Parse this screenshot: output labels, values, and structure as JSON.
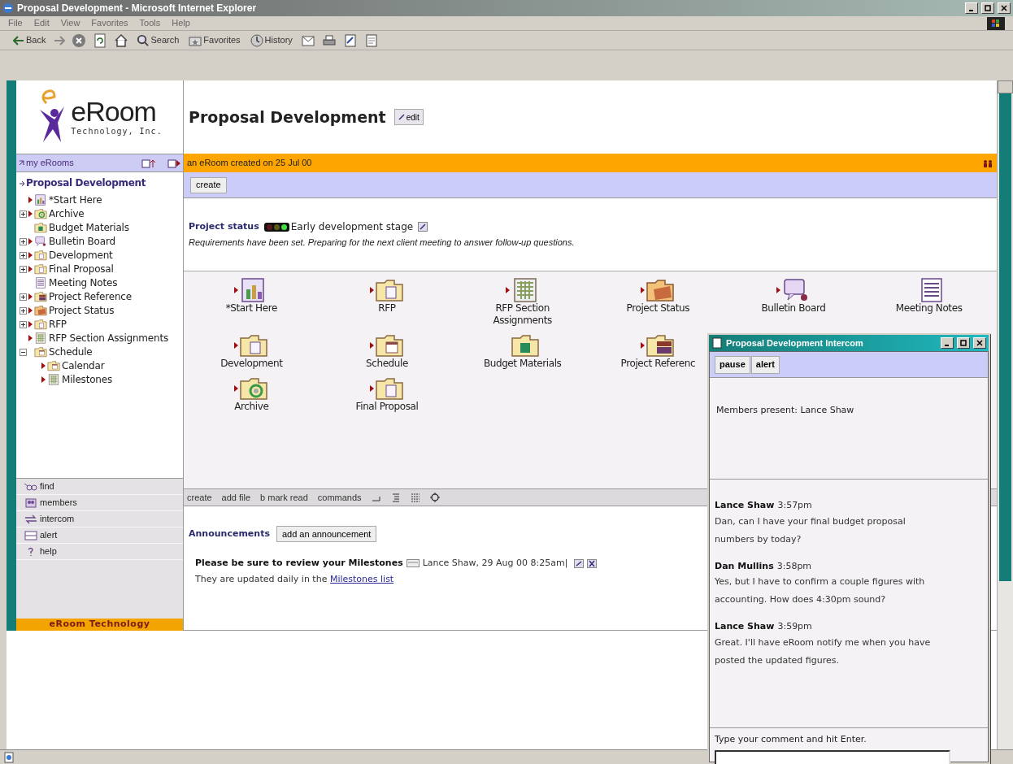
{
  "window": {
    "title": "Proposal Development - Microsoft Internet Explorer"
  },
  "menu": [
    "File",
    "Edit",
    "View",
    "Favorites",
    "Tools",
    "Help"
  ],
  "toolbar": [
    {
      "kind": "back",
      "label": "Back"
    },
    {
      "kind": "forward"
    },
    {
      "kind": "stop"
    },
    {
      "kind": "refresh"
    },
    {
      "kind": "home"
    },
    {
      "kind": "search",
      "label": "Search"
    },
    {
      "kind": "favorites",
      "label": "Favorites"
    },
    {
      "kind": "history",
      "label": "History"
    },
    {
      "kind": "mail"
    },
    {
      "kind": "print"
    },
    {
      "kind": "edit"
    },
    {
      "kind": "discuss"
    }
  ],
  "logo": {
    "name": "eRoom",
    "tagline": "Technology, Inc."
  },
  "sidebar": {
    "home_link": "my eRooms",
    "room_title": "Proposal Development",
    "tree": [
      {
        "label": "*Start Here",
        "kind": "start",
        "unread": true
      },
      {
        "label": "Archive",
        "kind": "recycle",
        "unread": true,
        "expanded": false
      },
      {
        "label": "Budget Materials",
        "kind": "money",
        "unread": false
      },
      {
        "label": "Bulletin Board",
        "kind": "board",
        "unread": true,
        "expanded": false
      },
      {
        "label": "Development",
        "kind": "folder",
        "unread": true,
        "expanded": false
      },
      {
        "label": "Final Proposal",
        "kind": "folder",
        "unread": true,
        "expanded": false
      },
      {
        "label": "Meeting Notes",
        "kind": "notes",
        "unread": false
      },
      {
        "label": "Project Reference",
        "kind": "books",
        "unread": true,
        "expanded": false
      },
      {
        "label": "Project Status",
        "kind": "status",
        "unread": true,
        "expanded": false
      },
      {
        "label": "RFP",
        "kind": "folder",
        "unread": true,
        "expanded": false
      },
      {
        "label": "RFP Section Assignments",
        "kind": "table",
        "unread": true
      },
      {
        "label": "Schedule",
        "kind": "calendar",
        "unread": false,
        "expanded": true,
        "children": [
          {
            "label": "Calendar",
            "kind": "calendar",
            "unread": true
          },
          {
            "label": "Milestones",
            "kind": "table",
            "unread": true
          }
        ]
      }
    ],
    "tools": [
      {
        "kind": "find",
        "label": "find"
      },
      {
        "kind": "members",
        "label": "members"
      },
      {
        "kind": "intercom",
        "label": "intercom"
      },
      {
        "kind": "alert",
        "label": "alert"
      },
      {
        "kind": "help",
        "label": "help"
      }
    ],
    "footer": "eRoom Technology"
  },
  "header": {
    "title": "Proposal Development",
    "edit": "edit"
  },
  "banner": "an eRoom created on 25 Jul 00",
  "create_button": "create",
  "project_status": {
    "label": "Project status",
    "lights": [
      {
        "color": "#5a1a1a"
      },
      {
        "color": "#5a5a1a"
      },
      {
        "color": "#40e040"
      }
    ],
    "stage": "Early development stage",
    "note": "Requirements have been set. Preparing for the next client meeting to answer follow-up questions."
  },
  "item_rows": [
    [
      {
        "label": "*Start Here",
        "kind": "start",
        "unread": true
      },
      {
        "label": "RFP",
        "kind": "folder",
        "unread": true
      },
      {
        "label": "RFP Section Assignments",
        "kind": "table",
        "unread": true
      },
      {
        "label": "Project Status",
        "kind": "status",
        "unread": true
      },
      {
        "label": "Bulletin Board",
        "kind": "board",
        "unread": true
      },
      {
        "label": "Meeting Notes",
        "kind": "notes",
        "unread": false
      }
    ],
    [
      {
        "label": "Development",
        "kind": "folder",
        "unread": true
      },
      {
        "label": "Schedule",
        "kind": "calendar",
        "unread": true
      },
      {
        "label": "Budget Materials",
        "kind": "money",
        "unread": false
      },
      {
        "label": "Project Referenc",
        "kind": "books",
        "unread": true
      }
    ],
    [
      {
        "label": "Archive",
        "kind": "recycle",
        "unread": true
      },
      {
        "label": "Final Proposal",
        "kind": "folder",
        "unread": true
      }
    ]
  ],
  "item_toolbar": [
    "create",
    "add file",
    "b mark read",
    "commands"
  ],
  "announcements": {
    "title": "Announcements",
    "add": "add an announcement",
    "posts": [
      {
        "title": "Please be sure to review your Milestones",
        "meta": "Lance Shaw, 29 Aug 00 8:25am|",
        "body": "They are updated daily in the",
        "link": "Milestones list"
      }
    ]
  },
  "intercom": {
    "title": "Proposal Development Intercom",
    "buttons": [
      "pause",
      "alert"
    ],
    "members": "Members present: Lance Shaw",
    "messages": [
      {
        "author": "Lance Shaw",
        "time": "3:57pm",
        "text": "Dan, can I have your final budget proposal numbers by today?"
      },
      {
        "author": "Dan Mullins",
        "time": "3:58pm",
        "text": "Yes, but I have to confirm a couple figures with accounting. How does 4:30pm sound?"
      },
      {
        "author": "Lance Shaw",
        "time": "3:59pm",
        "text": "Great. I'll have eRoom notify me when you have posted the updated figures."
      }
    ],
    "prompt": "Type your comment and hit Enter."
  }
}
